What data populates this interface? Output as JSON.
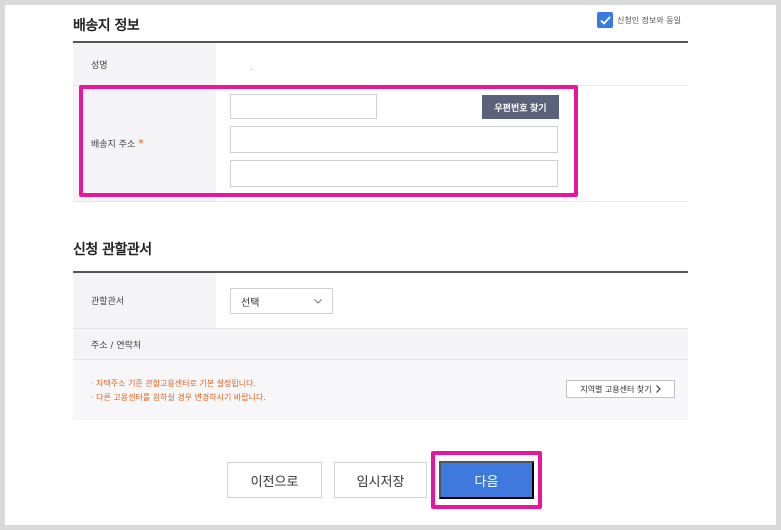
{
  "shipping": {
    "title": "배송지 정보",
    "same_as_applicant_label": "신청인 정보와 동일",
    "name_label": "성명",
    "name_value": ".",
    "address_label": "배송지 주소",
    "required_mark": "*",
    "postcode_button": "우편번호 찾기",
    "postcode_value": "",
    "address1_value": "",
    "address2_value": ""
  },
  "office": {
    "title": "신청 관할관서",
    "office_label": "관할관서",
    "office_select_value": "선택",
    "address_contact_label": "주소 / 연락처",
    "notes": [
      "· 자택주소 기준 관할고용센터로 기본 설정됩니다.",
      "· 다른 고용센터를 원하실 경우 변경하시기 바랍니다."
    ],
    "find_center_button": "지역별 고용센터 찾기"
  },
  "footer": {
    "prev_button": "이전으로",
    "save_button": "임시저장",
    "next_button": "다음"
  },
  "colors": {
    "highlight": "#e8169a",
    "primary": "#3f79de",
    "dark_button": "#5a6178",
    "note_text": "#e5621b"
  }
}
